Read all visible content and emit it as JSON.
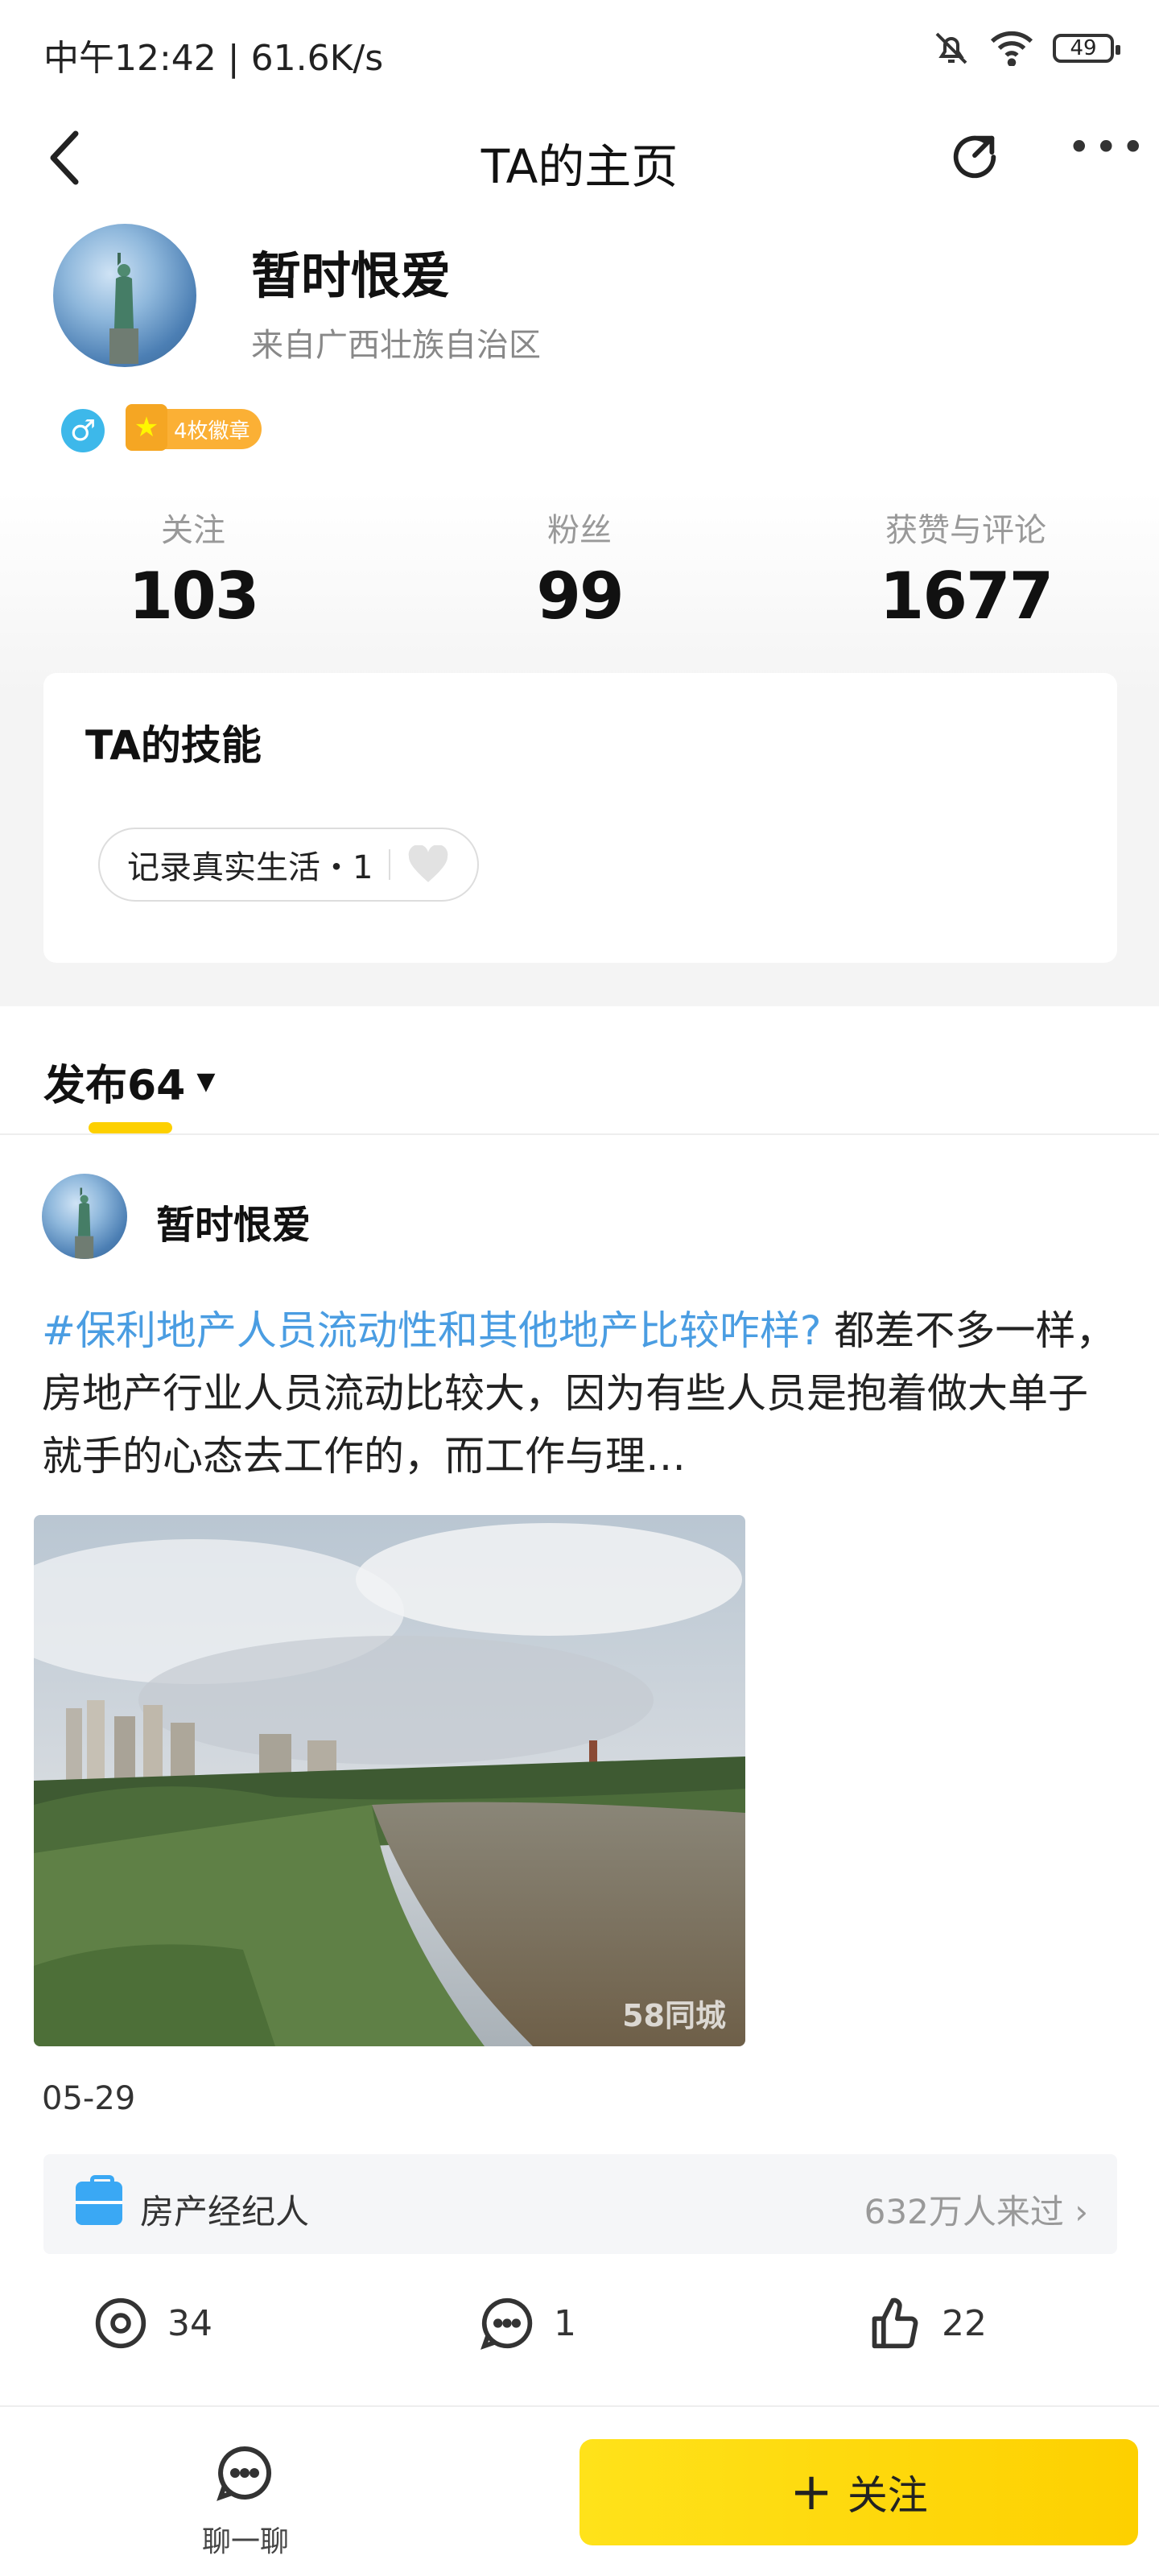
{
  "status_bar": {
    "time": "中午12:42 | 61.6K/s",
    "battery": "49"
  },
  "header": {
    "title": "TA的主页"
  },
  "profile": {
    "name": "暂时恨爱",
    "location": "来自广西壮族自治区",
    "gender_symbol": "♂",
    "badge_label": "4枚徽章"
  },
  "stats": [
    {
      "label": "关注",
      "value": "103"
    },
    {
      "label": "粉丝",
      "value": "99"
    },
    {
      "label": "获赞与评论",
      "value": "1677"
    }
  ],
  "skills": {
    "title": "TA的技能",
    "items": [
      {
        "label": "记录真实生活・1"
      }
    ]
  },
  "tabs": {
    "posts_label": "发布64"
  },
  "post": {
    "author": "暂时恨爱",
    "topic": "#保利地产人员流动性和其他地产比较咋样?",
    "body": " 都差不多一样，房地产行业人员流动比较大，因为有些人员是抱着做大单子就手的心态去工作的，而工作与理…",
    "watermark": "58同城",
    "date": "05-29",
    "info_label": "房产经纪人",
    "info_count": "632万人来过",
    "views": "34",
    "comments": "1",
    "likes": "22"
  },
  "bottom_bar": {
    "chat_label": "聊一聊",
    "follow_label": "关注"
  },
  "colors": {
    "accent_yellow": "#fdd000",
    "link_blue": "#4a9de2",
    "gender_blue": "#3db8ea"
  }
}
